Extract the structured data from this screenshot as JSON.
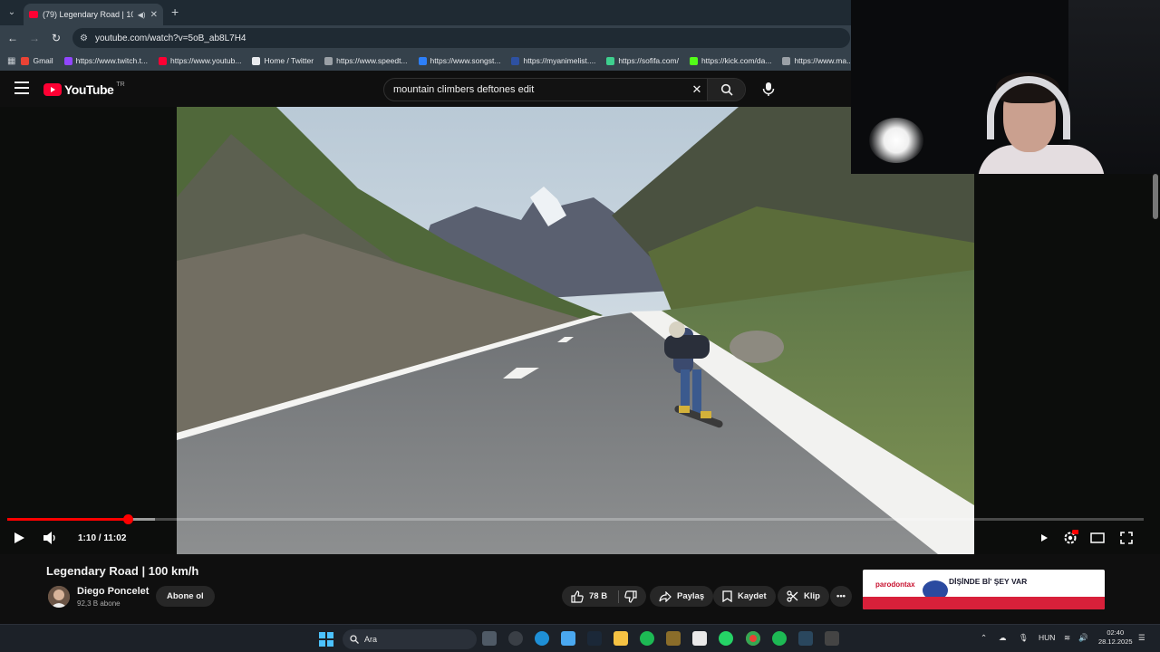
{
  "browser": {
    "tab": {
      "title": "(79) Legendary Road | 100 km/h",
      "audio_icon": "speaker-icon"
    },
    "address": {
      "url": "youtube.com/watch?v=5oB_ab8L7H4"
    },
    "bookmarks": [
      {
        "label": "Gmail",
        "color": "#ea4335"
      },
      {
        "label": "https://www.twitch.t...",
        "color": "#9146ff"
      },
      {
        "label": "https://www.youtub...",
        "color": "#ff0033"
      },
      {
        "label": "Home / Twitter",
        "color": "#e8eaed"
      },
      {
        "label": "https://www.speedt...",
        "color": "#9aa0a6"
      },
      {
        "label": "https://www.songst...",
        "color": "#2d7ff9"
      },
      {
        "label": "https://myanimelist....",
        "color": "#2e51a2"
      },
      {
        "label": "https://sofifa.com/",
        "color": "#3ecf8e"
      },
      {
        "label": "https://kick.com/da...",
        "color": "#53fc18"
      },
      {
        "label": "https://www.ma...",
        "color": "#9aa0a6"
      }
    ]
  },
  "youtube": {
    "logo_text": "YouTube",
    "country_code": "TR",
    "search": {
      "query": "mountain climbers deftones edit"
    }
  },
  "player": {
    "current_time": "1:10",
    "duration": "11:02",
    "time_display": "1:10 / 11:02",
    "progress_fraction": 0.106,
    "buffered_fraction": 0.13,
    "state": "paused"
  },
  "video": {
    "title": "Legendary Road | 100 km/h",
    "channel": "Diego Poncelet",
    "subscribers": "92,3 B abone",
    "subscribe_label": "Abone ol",
    "likes": "78 B",
    "share_label": "Paylaş",
    "save_label": "Kaydet",
    "clip_label": "Klip"
  },
  "ad": {
    "brand": "parodontax",
    "headline": "DİŞİNDE Bİ' ŞEY VAR"
  },
  "taskbar": {
    "search_label": "Ara",
    "language": "HUN",
    "time": "02:40",
    "date": "28.12.2025"
  }
}
